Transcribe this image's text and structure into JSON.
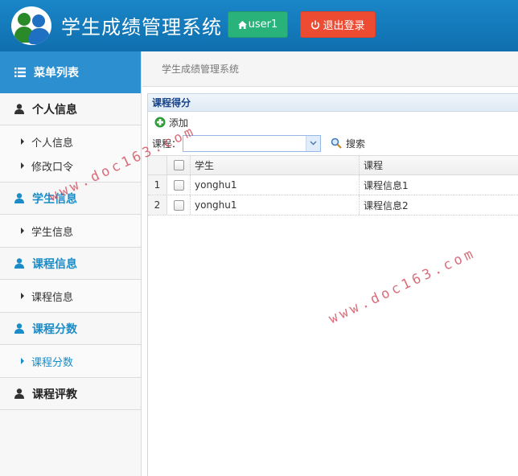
{
  "header": {
    "title": "学生成绩管理系统",
    "user_button": "user1",
    "logout_button": "退出登录"
  },
  "sidebar": {
    "menu_title": "菜单列表",
    "sections": [
      {
        "title": "个人信息",
        "items": [
          "个人信息",
          "修改口令"
        ]
      },
      {
        "title": "学生信息",
        "items": [
          "学生信息"
        ]
      },
      {
        "title": "课程信息",
        "items": [
          "课程信息"
        ]
      },
      {
        "title": "课程分数",
        "items": [
          "课程分数"
        ]
      },
      {
        "title": "课程评教",
        "items": []
      }
    ]
  },
  "main": {
    "breadcrumb": "学生成绩管理系统",
    "panel_title": "课程得分",
    "toolbar": {
      "add_label": "添加"
    },
    "search": {
      "label": "课程：",
      "value": "",
      "button": "搜索"
    },
    "table": {
      "columns": [
        "学生",
        "课程"
      ],
      "rows": [
        {
          "num": "1",
          "student": "yonghu1",
          "course": "课程信息1"
        },
        {
          "num": "2",
          "student": "yonghu1",
          "course": "课程信息2"
        }
      ]
    }
  },
  "watermarks": [
    "www.doc163.com",
    "www.doc163.com"
  ],
  "colors": {
    "header": "#1478bd",
    "accent": "#1a8cc8",
    "success": "#2ab27b",
    "danger": "#ee4b33"
  }
}
